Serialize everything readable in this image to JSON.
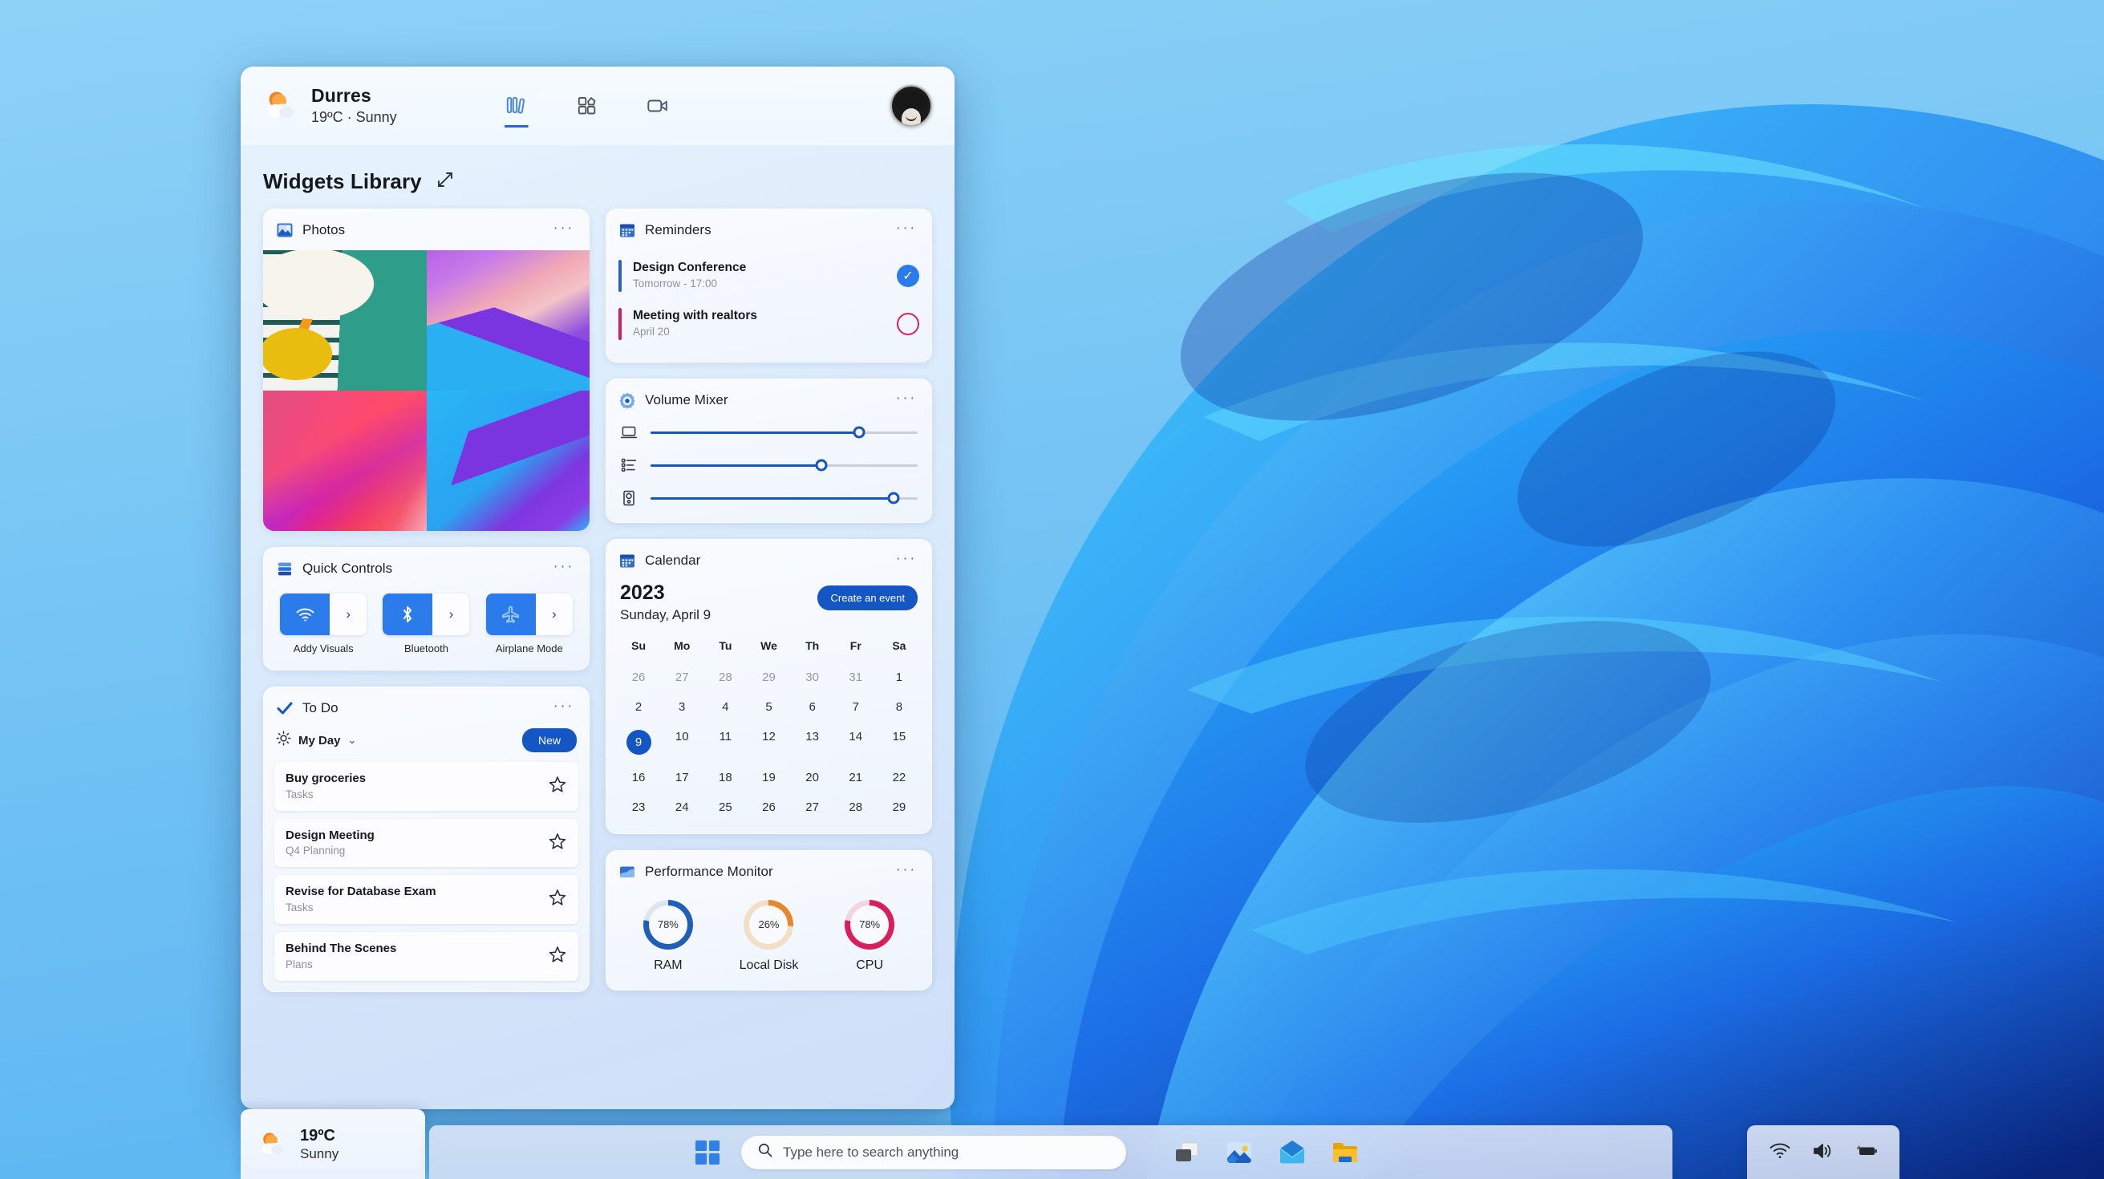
{
  "wallpaper": {
    "name": "windows-11-bloom",
    "base_color": "#2e7fe0",
    "sky_color": "#7ec8f5"
  },
  "panel": {
    "header": {
      "location": "Durres",
      "condition_line": "19ºC · Sunny",
      "weather_icon": "sun-behind-cloud-icon",
      "nav": [
        {
          "name": "library-view",
          "icon": "library-books-icon",
          "active": true
        },
        {
          "name": "widgets-grid-view",
          "icon": "widgets-grid-icon",
          "active": false
        },
        {
          "name": "video-view",
          "icon": "video-camera-icon",
          "active": false
        }
      ],
      "avatar_name": "user-avatar"
    },
    "library_title": "Widgets Library",
    "expand_icon": "expand-diagonal-icon"
  },
  "widgets": {
    "photos": {
      "title": "Photos",
      "icon": "photos-icon",
      "more": "···",
      "tiles": [
        "clock-fruit-photo",
        "purple-pink-gradient-photo",
        "red-magenta-gradient-photo",
        "blue-purple-gradient-photo"
      ]
    },
    "quick_controls": {
      "title": "Quick Controls",
      "icon": "quick-controls-icon",
      "more": "···",
      "items": [
        {
          "label": "Addy Visuals",
          "icon": "wifi-icon",
          "enabled": true,
          "chevron": "›"
        },
        {
          "label": "Bluetooth",
          "icon": "bluetooth-icon",
          "enabled": true,
          "chevron": "›"
        },
        {
          "label": "Airplane Mode",
          "icon": "airplane-icon",
          "enabled": true,
          "chevron": "›"
        }
      ]
    },
    "todo": {
      "title": "To Do",
      "icon": "todo-check-icon",
      "more": "···",
      "list_name": "My Day",
      "list_icon": "sun-icon",
      "chevron": "⌄",
      "new_button": "New",
      "items": [
        {
          "title": "Buy groceries",
          "sub": "Tasks",
          "star": "☆"
        },
        {
          "title": "Design Meeting",
          "sub": "Q4 Planning",
          "star": "☆"
        },
        {
          "title": "Revise for Database Exam",
          "sub": "Tasks",
          "star": "☆"
        },
        {
          "title": "Behind The Scenes",
          "sub": "Plans",
          "star": "☆"
        }
      ]
    },
    "reminders": {
      "title": "Reminders",
      "icon": "calendar-icon",
      "more": "···",
      "items": [
        {
          "title": "Design Conference",
          "when": "Tomorrow - 17:00",
          "bar_color": "#2b5fd0",
          "state": "done",
          "check": "✓"
        },
        {
          "title": "Meeting with realtors",
          "when": "April 20",
          "bar_color": "#d81e5b",
          "state": "open",
          "check": ""
        }
      ]
    },
    "volume_mixer": {
      "title": "Volume Mixer",
      "icon": "settings-gear-icon",
      "more": "···",
      "sliders": [
        {
          "name": "device-volume",
          "icon": "laptop-icon",
          "value": 78
        },
        {
          "name": "app-list-volume",
          "icon": "app-list-icon",
          "value": 64
        },
        {
          "name": "speaker-volume",
          "icon": "speaker-tower-icon",
          "value": 91
        }
      ]
    },
    "calendar": {
      "title": "Calendar",
      "icon": "calendar-icon",
      "more": "···",
      "year": "2023",
      "date_line": "Sunday, April 9",
      "create_button": "Create an event",
      "dow": [
        "Su",
        "Mo",
        "Tu",
        "We",
        "Th",
        "Fr",
        "Sa"
      ],
      "weeks": [
        [
          {
            "d": "26",
            "muted": true
          },
          {
            "d": "27",
            "muted": true
          },
          {
            "d": "28",
            "muted": true
          },
          {
            "d": "29",
            "muted": true
          },
          {
            "d": "30",
            "muted": true
          },
          {
            "d": "31",
            "muted": true
          },
          {
            "d": "1",
            "muted": false
          }
        ],
        [
          {
            "d": "2"
          },
          {
            "d": "3"
          },
          {
            "d": "4"
          },
          {
            "d": "5"
          },
          {
            "d": "6"
          },
          {
            "d": "7"
          },
          {
            "d": "8"
          }
        ],
        [
          {
            "d": "9",
            "today": true
          },
          {
            "d": "10"
          },
          {
            "d": "11"
          },
          {
            "d": "12"
          },
          {
            "d": "13"
          },
          {
            "d": "14"
          },
          {
            "d": "15"
          }
        ],
        [
          {
            "d": "16"
          },
          {
            "d": "17"
          },
          {
            "d": "18"
          },
          {
            "d": "19"
          },
          {
            "d": "20"
          },
          {
            "d": "21"
          },
          {
            "d": "22"
          }
        ],
        [
          {
            "d": "23"
          },
          {
            "d": "24"
          },
          {
            "d": "25"
          },
          {
            "d": "26"
          },
          {
            "d": "27"
          },
          {
            "d": "28"
          },
          {
            "d": "29"
          }
        ]
      ]
    },
    "performance": {
      "title": "Performance Monitor",
      "icon": "performance-icon",
      "more": "···",
      "gauges": [
        {
          "label": "RAM",
          "value": 78,
          "text": "78%",
          "color": "#1f5fb8"
        },
        {
          "label": "Local Disk",
          "value": 26,
          "text": "26%",
          "color": "#e8862a"
        },
        {
          "label": "CPU",
          "value": 78,
          "text": "78%",
          "color": "#d81e5b"
        }
      ]
    }
  },
  "taskbar": {
    "weather": {
      "temp": "19ºC",
      "condition": "Sunny",
      "icon": "sun-behind-cloud-icon"
    },
    "start": {
      "name": "start-button",
      "icon": "windows-logo-icon"
    },
    "search": {
      "placeholder": "Type here to search anything",
      "icon": "search-icon"
    },
    "apps": [
      {
        "name": "task-view",
        "icon": "task-view-icon"
      },
      {
        "name": "photos-app",
        "icon": "photos-app-icon"
      },
      {
        "name": "mail-app",
        "icon": "mail-app-icon"
      },
      {
        "name": "file-explorer",
        "icon": "folder-icon"
      }
    ],
    "tray": [
      {
        "name": "wifi",
        "icon": "wifi-icon"
      },
      {
        "name": "volume",
        "icon": "speaker-icon"
      },
      {
        "name": "battery",
        "icon": "battery-charging-icon"
      }
    ]
  }
}
